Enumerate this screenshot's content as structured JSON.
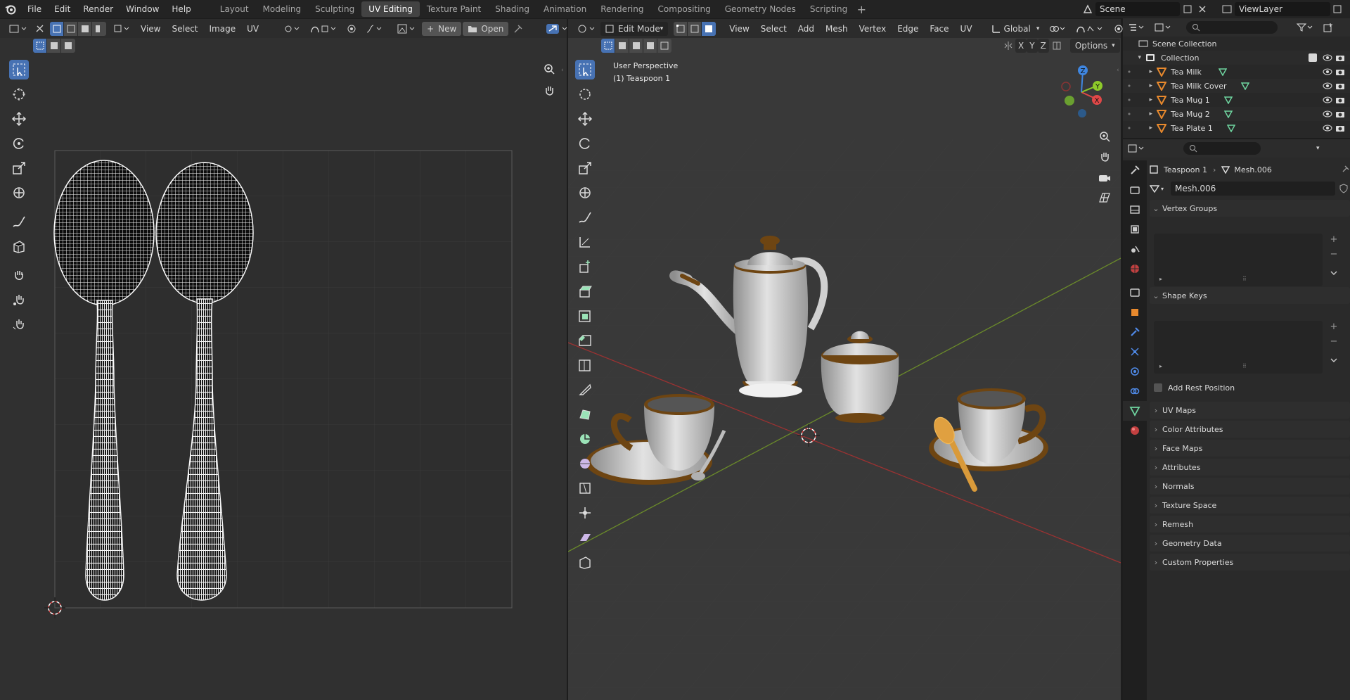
{
  "topbar": {
    "menus": [
      "File",
      "Edit",
      "Render",
      "Window",
      "Help"
    ],
    "workspaces": [
      "Layout",
      "Modeling",
      "Sculpting",
      "UV Editing",
      "Texture Paint",
      "Shading",
      "Animation",
      "Rendering",
      "Compositing",
      "Geometry Nodes",
      "Scripting"
    ],
    "active_workspace": "UV Editing",
    "scene_name": "Scene",
    "view_layer": "ViewLayer"
  },
  "uv_editor": {
    "menus": [
      "View",
      "Select",
      "Image",
      "UV"
    ],
    "new_label": "New",
    "open_label": "Open"
  },
  "viewport": {
    "mode": "Edit Mode",
    "menus": [
      "View",
      "Select",
      "Add",
      "Mesh",
      "Vertex",
      "Edge",
      "Face",
      "UV"
    ],
    "transform_orientation": "Global",
    "axis_x": "X",
    "axis_y": "Y",
    "axis_z": "Z",
    "options_label": "Options",
    "overlay_line1": "User Perspective",
    "overlay_line2": "(1) Teaspoon 1",
    "gizmo": {
      "x": "X",
      "y": "Y",
      "z": "Z"
    }
  },
  "outliner": {
    "scene_collection": "Scene Collection",
    "collection": "Collection",
    "items": [
      "Tea Milk",
      "Tea Milk Cover",
      "Tea Mug 1",
      "Tea Mug 2",
      "Tea Plate 1"
    ]
  },
  "properties": {
    "object": "Teaspoon 1",
    "mesh": "Mesh.006",
    "datablock": "Mesh.006",
    "vertex_groups": "Vertex Groups",
    "shape_keys": "Shape Keys",
    "add_rest_position": "Add Rest Position",
    "collapsed_panels": [
      "UV Maps",
      "Color Attributes",
      "Face Maps",
      "Attributes",
      "Normals",
      "Texture Space",
      "Remesh",
      "Geometry Data",
      "Custom Properties"
    ]
  }
}
